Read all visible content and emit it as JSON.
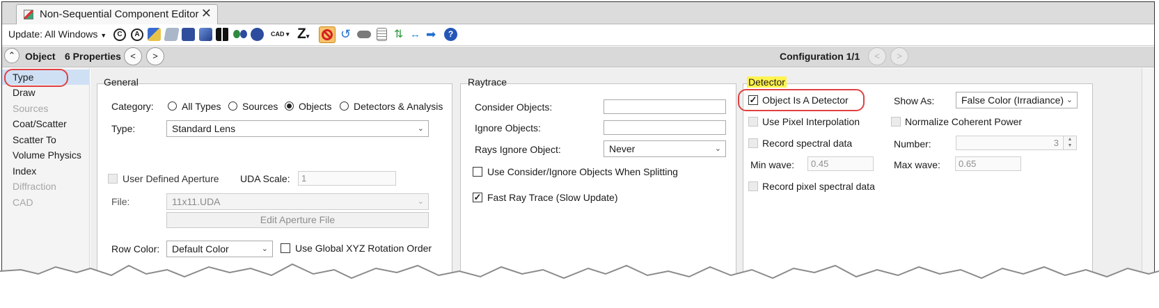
{
  "window": {
    "tab_title": "Non-Sequential Component Editor"
  },
  "toolbar": {
    "update_label": "Update: All Windows",
    "cad_label": "CAD",
    "z_label": "Z"
  },
  "header": {
    "object_label": "Object",
    "properties_label": "6 Properties",
    "configuration_label": "Configuration 1/1"
  },
  "sidebar": {
    "items": [
      {
        "label": "Type"
      },
      {
        "label": "Draw"
      },
      {
        "label": "Sources"
      },
      {
        "label": "Coat/Scatter"
      },
      {
        "label": "Scatter To"
      },
      {
        "label": "Volume Physics"
      },
      {
        "label": "Index"
      },
      {
        "label": "Diffraction"
      },
      {
        "label": "CAD"
      }
    ]
  },
  "general": {
    "title": "General",
    "category_label": "Category:",
    "category_options": [
      "All Types",
      "Sources",
      "Objects",
      "Detectors & Analysis"
    ],
    "type_label": "Type:",
    "type_value": "Standard Lens",
    "uda_checkbox_label": "User Defined Aperture",
    "uda_scale_label": "UDA Scale:",
    "uda_scale_value": "1",
    "file_label": "File:",
    "file_value": "11x11.UDA",
    "edit_aperture_button": "Edit Aperture File",
    "row_color_label": "Row Color:",
    "row_color_value": "Default Color",
    "global_xyz_label": "Use Global XYZ Rotation Order"
  },
  "raytrace": {
    "title": "Raytrace",
    "consider_label": "Consider Objects:",
    "consider_value": "",
    "ignore_label": "Ignore Objects:",
    "ignore_value": "",
    "rays_ignore_label": "Rays Ignore Object:",
    "rays_ignore_value": "Never",
    "splitting_label": "Use Consider/Ignore Objects When Splitting",
    "fast_label": "Fast Ray Trace (Slow Update)"
  },
  "detector": {
    "title": "Detector",
    "is_detector_label": "Object Is A Detector",
    "show_as_label": "Show As:",
    "show_as_value": "False Color (Irradiance)",
    "pixel_interp_label": "Use Pixel Interpolation",
    "normalize_label": "Normalize Coherent Power",
    "record_spectral_label": "Record spectral data",
    "number_label": "Number:",
    "number_value": "3",
    "min_wave_label": "Min wave:",
    "min_wave_value": "0.45",
    "max_wave_label": "Max wave:",
    "max_wave_value": "0.65",
    "record_pixel_label": "Record pixel spectral data"
  },
  "colors": {
    "highlight": "#fff34d",
    "annotation_ring": "#e04040",
    "selected_item": "#cfe0f5"
  }
}
